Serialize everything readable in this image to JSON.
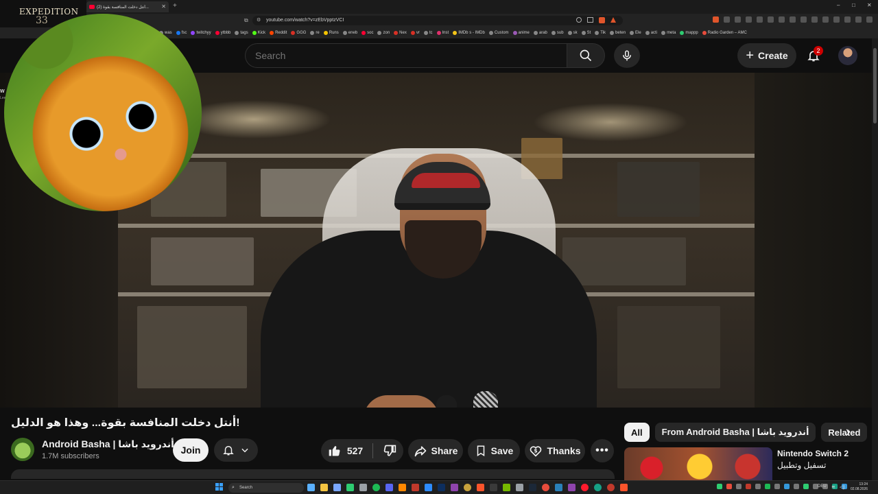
{
  "browser": {
    "tab_title": "(2) أنتل دخلت المنافسة بقوة...",
    "url": "youtube.com/watch?v=zEbVpptzVCI",
    "new_tab_label": "+",
    "bookmarks": [
      "was",
      "fsc",
      "twitchyy",
      "ytbbb",
      "tags",
      "Kick",
      "Reddit",
      "GGG",
      "re",
      "Runs",
      "eneb",
      "soc",
      "zon",
      "Nex",
      "vr",
      "tc",
      "Inst",
      "IMDb s - IMDb",
      "Custom",
      "anime",
      "arab",
      "sub",
      "sk",
      "St",
      "Tik",
      "beten",
      "Ele",
      "acti",
      "meta",
      "mappp",
      "Radio Garden – AMC"
    ]
  },
  "header": {
    "search_placeholder": "Search",
    "create_label": "Create",
    "notification_count": "2"
  },
  "overlay": {
    "game_title": "EXPEDITION",
    "game_number": "33",
    "side_peek_1": "W",
    "side_peek_2": "Lee"
  },
  "video": {
    "title": "!أنتل دخلت المنافسة بقوة... وهذا هو الدليل",
    "channel_name": "Android Basha | أندرويد باشا",
    "subscribers": "1.7M subscribers",
    "join_label": "Join",
    "likes": "527",
    "share_label": "Share",
    "save_label": "Save",
    "thanks_label": "Thanks"
  },
  "sidebar": {
    "chips": [
      "All",
      "From Android Basha | أندرويد باشا",
      "Related"
    ],
    "active_chip": "All",
    "recommendation": {
      "title": "Nintendo Switch 2",
      "subtitle": "تسفيل وتطبيل"
    }
  },
  "taskbar": {
    "search_label": "Search",
    "language": "DEU",
    "time": "13:24",
    "date": "02.08.2026"
  },
  "colors": {
    "background": "#0f0f0f",
    "surface": "#272727",
    "text": "#f1f1f1",
    "muted": "#aaaaaa",
    "youtube_red": "#ff0033",
    "badge_red": "#cc0000"
  }
}
